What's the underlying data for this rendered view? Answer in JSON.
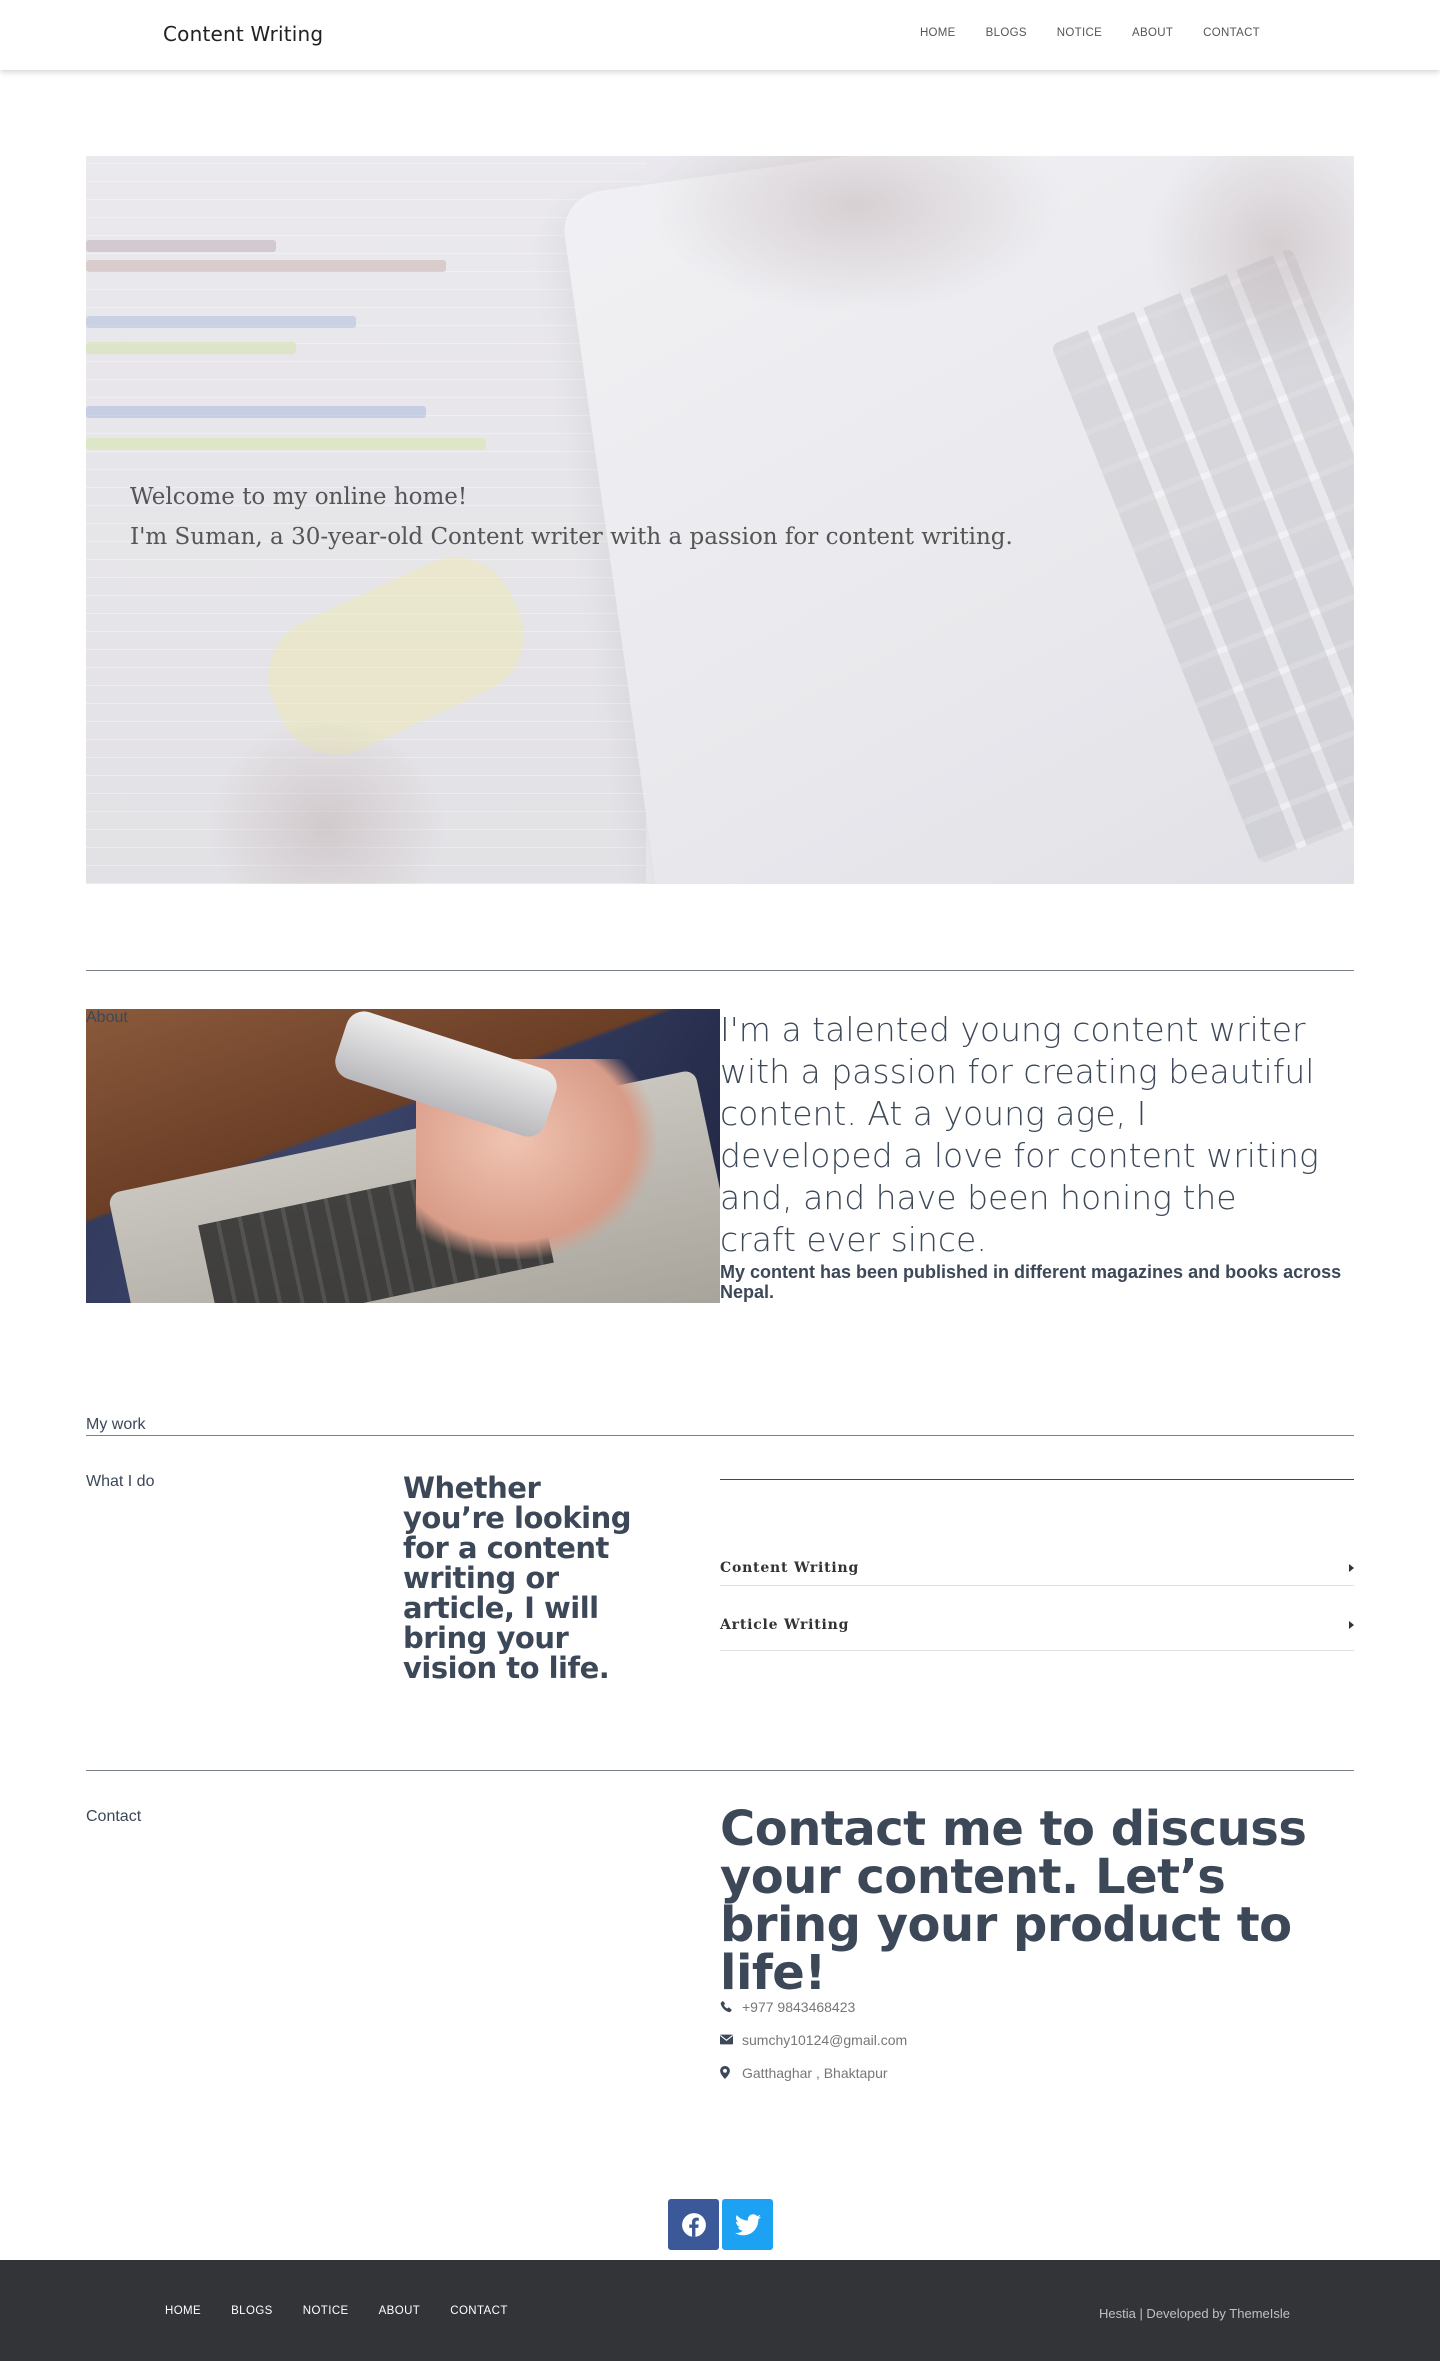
{
  "header": {
    "brand": "Content Writing",
    "nav": [
      "HOME",
      "BLOGS",
      "NOTICE",
      "ABOUT",
      "CONTACT"
    ]
  },
  "hero": {
    "title": "Welcome to my online home!",
    "subtitle": "I'm Suman, a 30-year-old Content writer with a passion for content writing."
  },
  "about": {
    "label": "About",
    "heading": "I'm a talented young content writer with a passion for creating beautiful content. At a young age, I developed a love for content writing and, and have been honing the craft ever since.",
    "body": "My content has been published in different magazines and books across Nepal."
  },
  "work": {
    "label": "My work",
    "what_i_do": "What I do",
    "heading": "Whether you’re looking for a content writing or article, I will bring your vision to life.",
    "items": [
      "Content Writing",
      "Article Writing"
    ]
  },
  "contact": {
    "label": "Contact",
    "heading": "Contact me to discuss your content. Let’s bring your product to life!",
    "phone": "+977 9843468423",
    "email": "sumchy10124@gmail.com",
    "address": "Gatthaghar , Bhaktapur"
  },
  "social": {
    "icons": [
      "facebook-icon",
      "twitter-icon"
    ]
  },
  "footer": {
    "nav": [
      "HOME",
      "BLOGS",
      "NOTICE",
      "ABOUT",
      "CONTACT"
    ],
    "credit": "Hestia | Developed by ThemeIsle"
  },
  "colors": {
    "text": "#3c4858",
    "footer_bg": "#323437",
    "facebook": "#3b5998",
    "twitter": "#1da1f2"
  }
}
